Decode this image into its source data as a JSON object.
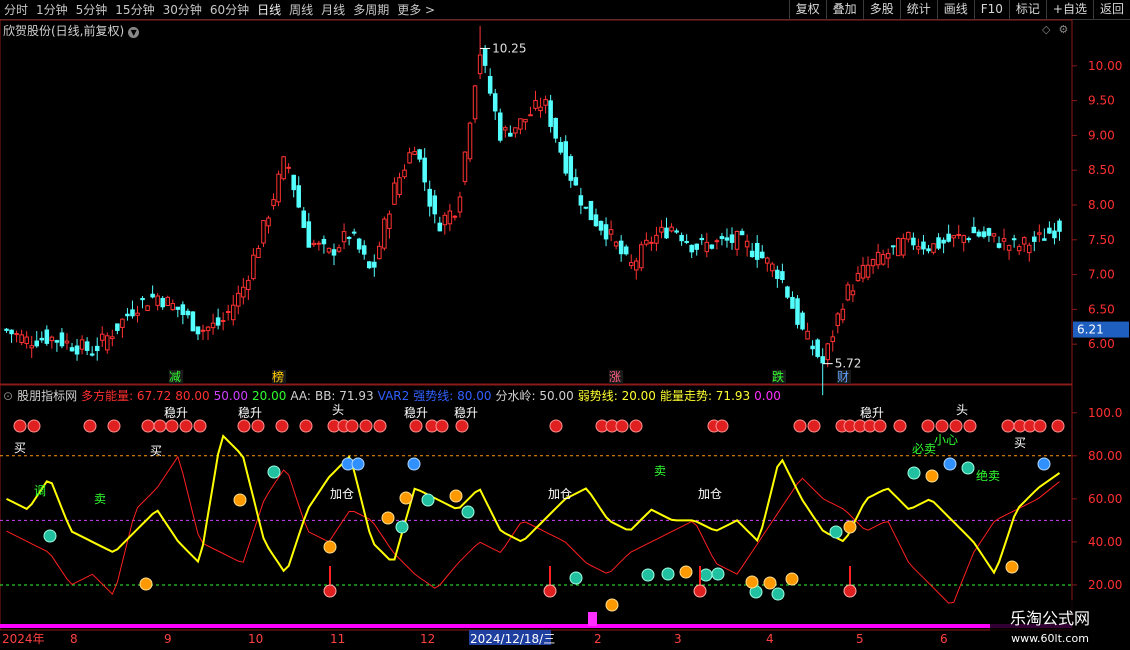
{
  "toolbar": {
    "periods": [
      "分时",
      "1分钟",
      "5分钟",
      "15分钟",
      "30分钟",
      "60分钟",
      "日线",
      "周线",
      "月线",
      "多周期",
      "更多"
    ],
    "active_period": "日线",
    "more_arrow": ">",
    "right_buttons": [
      "复权",
      "叠加",
      "多股",
      "统计",
      "画线",
      "F10",
      "标记",
      "+自选",
      "返回"
    ]
  },
  "stock": {
    "title": "欣贺股份(日线,前复权)",
    "current_price_label": "6.21",
    "high_label": "10.25",
    "low_label": "5.72"
  },
  "indicator": {
    "name": "股朋指标网",
    "fields": [
      {
        "label": "多方能量:",
        "value": "67.72",
        "color": "#ff3030"
      },
      {
        "label": "",
        "value": "80.00",
        "color": "#ff3030"
      },
      {
        "label": "",
        "value": "50.00",
        "color": "#d040ff"
      },
      {
        "label": "",
        "value": "20.00",
        "color": "#30ff30"
      },
      {
        "label": "AA:",
        "value": "",
        "color": "#d0d0d0"
      },
      {
        "label": "BB:",
        "value": "71.93",
        "color": "#d0d0d0"
      },
      {
        "label": "VAR2",
        "value": "",
        "color": "#3060ff"
      },
      {
        "label": "强势线:",
        "value": "80.00",
        "color": "#3060ff"
      },
      {
        "label": "分水岭:",
        "value": "50.00",
        "color": "#d0d0d0"
      },
      {
        "label": "弱势线:",
        "value": "20.00",
        "color": "#ffff30"
      },
      {
        "label": "能量走势:",
        "value": "71.93",
        "color": "#ffff30"
      },
      {
        "label": "",
        "value": "0.00",
        "color": "#ff30ff"
      }
    ]
  },
  "colors": {
    "up": "#ff3232",
    "down": "#54ffff",
    "yellow_line": "#ffff00",
    "red_line": "#ff2020",
    "line80": "#ff9900",
    "line50": "#d040ff",
    "line20": "#30ff30"
  },
  "chart_data": {
    "type": "candlestick",
    "price_axis": {
      "ticks": [
        "10.00",
        "9.50",
        "9.00",
        "8.50",
        "8.00",
        "7.50",
        "7.00",
        "6.50",
        "6.00"
      ],
      "range": [
        5.6,
        10.4
      ]
    },
    "indicator_axis": {
      "ticks": [
        "100.0",
        "80.00",
        "60.00",
        "40.00",
        "20.00"
      ],
      "range": [
        0,
        105
      ]
    },
    "date_labels": [
      "2024年",
      "8",
      "9",
      "10",
      "11",
      "12",
      "2024/12/18/三",
      "2",
      "3",
      "4",
      "5",
      "6"
    ],
    "bottom_markers": [
      {
        "text": "减",
        "color": "#30ff30"
      },
      {
        "text": "榜",
        "color": "#ffcc00"
      },
      {
        "text": "涨",
        "color": "#ff6080"
      },
      {
        "text": "跌",
        "color": "#30ff30"
      },
      {
        "text": "财",
        "color": "#60a0ff"
      }
    ],
    "close_keypoints": [
      6.2,
      6.05,
      6.1,
      6.0,
      5.9,
      6.2,
      6.55,
      6.7,
      6.5,
      6.2,
      6.3,
      6.8,
      7.7,
      8.7,
      7.5,
      7.3,
      7.6,
      7.0,
      8.2,
      8.9,
      7.7,
      8.0,
      10.25,
      9.0,
      9.2,
      9.5,
      8.6,
      7.9,
      7.6,
      7.1,
      7.5,
      7.7,
      7.4,
      7.45,
      7.5,
      7.3,
      7.0,
      6.2,
      5.72,
      6.7,
      7.1,
      7.3,
      7.5,
      7.4,
      7.5,
      7.6,
      7.5,
      7.4,
      7.5,
      7.7
    ],
    "yellow_keypoints": [
      60,
      55,
      70,
      45,
      40,
      35,
      45,
      55,
      40,
      30,
      90,
      80,
      40,
      25,
      55,
      70,
      80,
      40,
      30,
      65,
      60,
      55,
      65,
      45,
      40,
      50,
      60,
      65,
      50,
      45,
      55,
      50,
      50,
      45,
      50,
      40,
      80,
      60,
      45,
      40,
      60,
      65,
      55,
      60,
      50,
      40,
      25,
      55,
      65,
      72
    ],
    "red_keypoints": [
      45,
      40,
      35,
      20,
      25,
      15,
      55,
      65,
      80,
      40,
      35,
      30,
      60,
      75,
      45,
      40,
      55,
      50,
      35,
      25,
      18,
      30,
      40,
      35,
      50,
      45,
      40,
      30,
      25,
      35,
      40,
      45,
      50,
      30,
      25,
      40,
      55,
      70,
      60,
      55,
      45,
      50,
      30,
      20,
      10,
      35,
      50,
      55,
      60,
      68
    ],
    "labels": [
      "稳升",
      "稳升",
      "头",
      "稳升",
      "稳升",
      "稳升",
      "买",
      "买",
      "卖",
      "调",
      "加仓",
      "卖",
      "必卖",
      "小心",
      "绝卖",
      "加仓",
      "加仓",
      "买",
      "头"
    ]
  }
}
